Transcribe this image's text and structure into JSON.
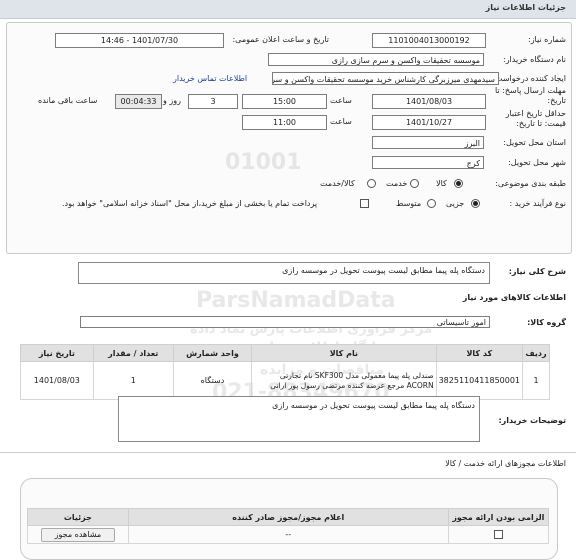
{
  "header": {
    "title": "جزئیات اطلاعات نیاز"
  },
  "fields": {
    "need_number_label": "شماره نیاز:",
    "need_number": "1101004013000192",
    "announce_label": "تاریخ و ساعت اعلان عمومی:",
    "announce_value": "1401/07/30 - 14:46",
    "buyer_label": "نام دستگاه خریدار:",
    "buyer_value": "موسسه تحقیقات واکسن و سرم سازی رازی",
    "creator_label": "ایجاد کننده درخواست:",
    "creator_value": "سیدمهدی میرزبرگی کارشناس خرید موسسه تحقیقات واکسن و سرم سازی رازی",
    "contact_link": "اطلاعات تماس خریدار",
    "deadline_label": "مهلت ارسال پاسخ: تا تاریخ:",
    "deadline_date": "1401/08/03",
    "time_label": "ساعت",
    "deadline_time": "15:00",
    "days_value": "3",
    "days_label": "روز و",
    "remaining_value": "00:04:33",
    "remaining_label": "ساعت باقی مانده",
    "validity_label": "حداقل تاریخ اعتبار قیمت: تا تاریخ:",
    "validity_date": "1401/10/27",
    "validity_time": "11:00",
    "province_label": "استان محل تحویل:",
    "province_value": "البرز",
    "city_label": "شهر محل تحویل:",
    "city_value": "کرج",
    "category_label": "طبقه بندی موضوعی:",
    "category_options": [
      "کالا",
      "خدمت",
      "کالا/خدمت"
    ],
    "process_label": "نوع فرآیند خرید :",
    "process_options": [
      "جزیی",
      "متوسط"
    ],
    "payment_note": "پرداخت تمام یا بخشی از مبلغ خرید،از محل \"اسناد خزانه اسلامی\" خواهد بود."
  },
  "description": {
    "label": "شرح کلی نیاز:",
    "value": "دستگاه پله پیما مطابق لیست پیوست تحویل در موسسه رازی"
  },
  "goods": {
    "section_title": "اطلاعات کالاهای مورد نیاز",
    "group_label": "گروه کالا:",
    "group_value": "امور تاسیساتی",
    "columns": [
      "ردیف",
      "کد کالا",
      "نام کالا",
      "واحد شمارش",
      "تعداد / مقدار",
      "تاریخ نیاز"
    ],
    "rows": [
      {
        "row": "1",
        "code": "3825110411850001",
        "name": "صندلی پله پیما معمولی مدل SKF300 نام تجارتی ACORN مرجع عرضه کننده مرتضی رسول پور ارانی",
        "unit": "دستگاه",
        "qty": "1",
        "date": "1401/08/03"
      }
    ],
    "notes_label": "توضیحات خریدار:",
    "notes_value": "دستگاه پله پیما مطابق لیست پیوست تحویل در موسسه رازی"
  },
  "services": {
    "section_title": "اطلاعات مجوزهای ارائه خدمت / کالا",
    "columns": [
      "الزامی بودن ارائه مجوز",
      "اعلام مجوز/مجوز صادر کننده",
      "جزئیات"
    ],
    "row_value": "--",
    "button_label": "مشاهده مجوز"
  },
  "watermark": {
    "lines": [
      "01001",
      "ParsNamadData",
      "مرکز فراوری اطلاعات پارس نماد داده",
      "پایگاه اطلاع رسانی",
      "مناقصات و مزایده",
      "021-88349670"
    ]
  }
}
